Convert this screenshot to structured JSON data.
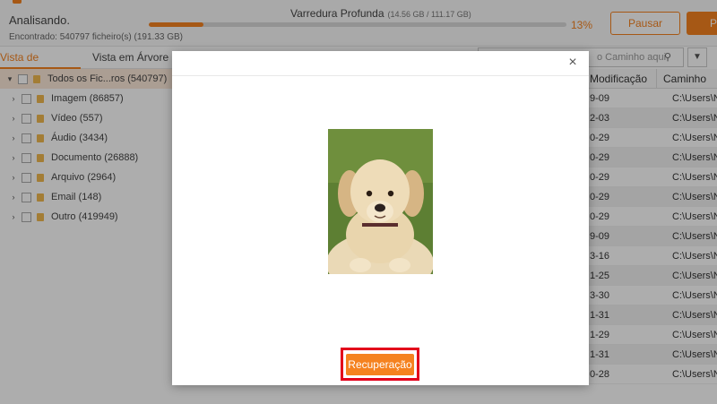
{
  "header": {
    "status": "Analisando.",
    "found": "Encontrado: 540797 ficheiro(s) (191.33 GB)",
    "scan_title": "Varredura Profunda",
    "scan_size": "(14.56 GB / 111.17 GB)",
    "progress_percent": "13%",
    "progress_value": 0.13,
    "pause_label": "Pausar",
    "stop_label": "P"
  },
  "tabs": {
    "file_view": "Vista de Ficheiros",
    "tree_view": "Vista em Árvore"
  },
  "tree": {
    "root": "Todos os Fic...ros (540797)",
    "items": [
      {
        "label": "Imagem (86857)"
      },
      {
        "label": "Vídeo (557)"
      },
      {
        "label": "Áudio (3434)"
      },
      {
        "label": "Documento (26888)"
      },
      {
        "label": "Arquivo (2964)"
      },
      {
        "label": "Email (148)"
      },
      {
        "label": "Outro (419949)"
      }
    ]
  },
  "search": {
    "placeholder": "o Caminho aqui"
  },
  "table": {
    "col_modified": "Modificação",
    "col_path": "Caminho",
    "rows": [
      {
        "mod": "9-09",
        "path": "C:\\Users\\N"
      },
      {
        "mod": "2-03",
        "path": "C:\\Users\\N"
      },
      {
        "mod": "0-29",
        "path": "C:\\Users\\N"
      },
      {
        "mod": "0-29",
        "path": "C:\\Users\\N"
      },
      {
        "mod": "0-29",
        "path": "C:\\Users\\N"
      },
      {
        "mod": "0-29",
        "path": "C:\\Users\\N"
      },
      {
        "mod": "0-29",
        "path": "C:\\Users\\N"
      },
      {
        "mod": "9-09",
        "path": "C:\\Users\\N"
      },
      {
        "mod": "3-16",
        "path": "C:\\Users\\N"
      },
      {
        "mod": "1-25",
        "path": "C:\\Users\\N"
      },
      {
        "mod": "3-30",
        "path": "C:\\Users\\N"
      },
      {
        "mod": "1-31",
        "path": "C:\\Users\\N"
      },
      {
        "mod": "1-29",
        "path": "C:\\Users\\N"
      },
      {
        "mod": "1-31",
        "path": "C:\\Users\\N"
      },
      {
        "mod": "0-28",
        "path": "C:\\Users\\N"
      }
    ]
  },
  "modal": {
    "close_symbol": "×",
    "recover_label": "Recuperação"
  },
  "icons": {
    "close": "close-icon",
    "search": "search-icon",
    "filter": "filter-icon",
    "folder": "folder-icon"
  },
  "colors": {
    "accent": "#f5821f",
    "highlight": "#e3001b"
  }
}
